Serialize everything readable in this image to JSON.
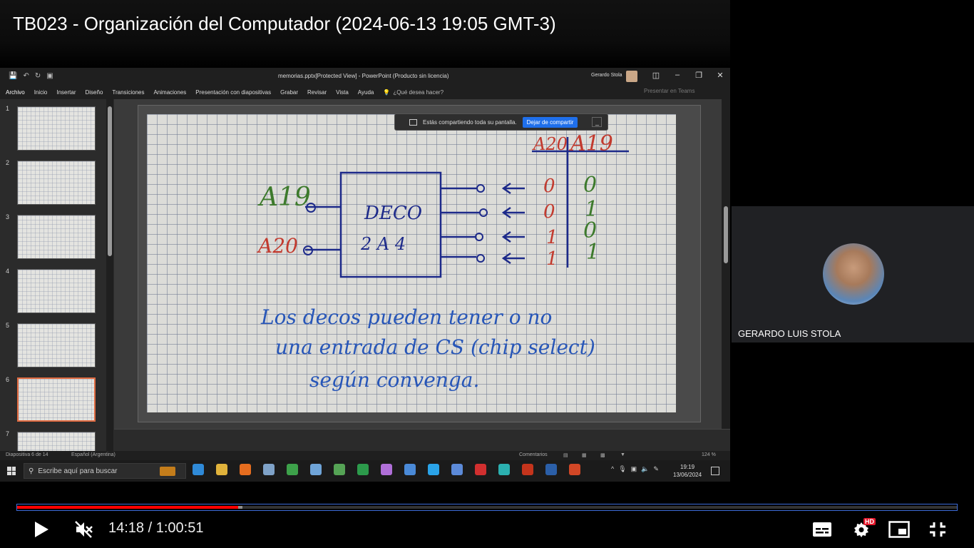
{
  "video": {
    "title": "TB023 - Organización del Computador (2024-06-13 19:05 GMT-3)",
    "current_time": "14:18",
    "duration": "1:00:51",
    "time_display": "14:18 / 1:00:51",
    "progress_played": 0.235,
    "progress_loaded": 0.24,
    "muted": true
  },
  "powerpoint": {
    "doc_title": "memorias.pptx[Protected View] - PowerPoint (Producto sin licencia)",
    "user_name": "Gerardo Stola",
    "ribbon_tabs": [
      "Archivo",
      "Inicio",
      "Insertar",
      "Diseño",
      "Transiciones",
      "Animaciones",
      "Presentación con diapositivas",
      "Grabar",
      "Revisar",
      "Vista",
      "Ayuda"
    ],
    "search_hint": "¿Qué desea hacer?",
    "present_teams": "Presentar en Teams",
    "slide_numbers": [
      "1",
      "2",
      "3",
      "4",
      "5",
      "6",
      "7"
    ],
    "active_slide": 6,
    "status_slide": "Diapositiva 6 de 14",
    "status_lang": "Español (Argentina)",
    "status_comments": "Comentarios",
    "zoom": "124 %"
  },
  "share_bar": {
    "message": "Estás compartiendo toda su pantalla.",
    "stop_label": "Dejar de compartir",
    "minimize_label": "_"
  },
  "slide_content": {
    "input_high": "A19",
    "input_low": "A20",
    "block_line1": "DECO",
    "block_line2": "2 A 4",
    "table_header_a": "A20",
    "table_header_b": "A19",
    "col_a": [
      "0",
      "0",
      "1",
      "1"
    ],
    "col_b": [
      "0",
      "1",
      "0",
      "1"
    ],
    "note_line1": "Los decos pueden tener o no",
    "note_line2": "una entrada de  CS  (chip select)",
    "note_line3": "según convenga."
  },
  "taskbar": {
    "search_placeholder": "Escribe aquí para buscar",
    "clock_time": "19:19",
    "clock_date": "13/06/2024",
    "app_colors": [
      "#2f8ad8",
      "#e0b23b",
      "#e66d1f",
      "#7fa2c8",
      "#3da14a",
      "#6fa4d8",
      "#55a355",
      "#2c9a4b",
      "#b06fd8",
      "#4a8ad8",
      "#2aa3e8",
      "#5c8ad8",
      "#d12f2f",
      "#2bb0b0",
      "#c4341c",
      "#2b5fa8",
      "#d24726"
    ]
  },
  "participant": {
    "name": "GERARDO LUIS STOLA"
  },
  "colors": {
    "progress_red": "#ff0000",
    "progress_border": "#3d6bd8",
    "hd_badge": "#e5172b",
    "active_slide_border": "#e06b41",
    "share_button": "#1f6feb"
  },
  "controls": {
    "hd_label": "HD",
    "icons": [
      "play-icon",
      "mute-icon",
      "subtitles-icon",
      "settings-icon",
      "miniplayer-icon",
      "exit-fullscreen-icon"
    ]
  }
}
